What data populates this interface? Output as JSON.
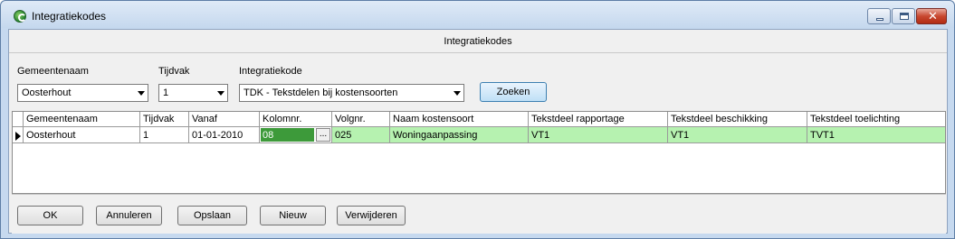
{
  "window": {
    "title": "Integratiekodes",
    "colors": {
      "frame": "#c6d9ef",
      "row_highlight": "#b6f2b0",
      "selected_cell": "#3d9a3a"
    }
  },
  "header": {
    "title": "Integratiekodes"
  },
  "filters": {
    "gemeentenaam": {
      "label": "Gemeentenaam",
      "value": "Oosterhout"
    },
    "tijdvak": {
      "label": "Tijdvak",
      "value": "1"
    },
    "integratiekode": {
      "label": "Integratiekode",
      "value": "TDK - Tekstdelen bij kostensoorten"
    },
    "search_button": "Zoeken"
  },
  "grid": {
    "columns": [
      "Gemeentenaam",
      "Tijdvak",
      "Vanaf",
      "Kolomnr.",
      "Volgnr.",
      "Naam kostensoort",
      "Tekstdeel rapportage",
      "Tekstdeel beschikking",
      "Tekstdeel toelichting"
    ],
    "rows": [
      [
        "Oosterhout",
        "1",
        "01-01-2010",
        "08",
        "025",
        "Woningaanpassing",
        "VT1",
        "VT1",
        "TVT1"
      ]
    ],
    "ellipsis_label": "..."
  },
  "buttons": {
    "ok": "OK",
    "annuleren": "Annuleren",
    "opslaan": "Opslaan",
    "nieuw": "Nieuw",
    "verwijderen": "Verwijderen"
  }
}
